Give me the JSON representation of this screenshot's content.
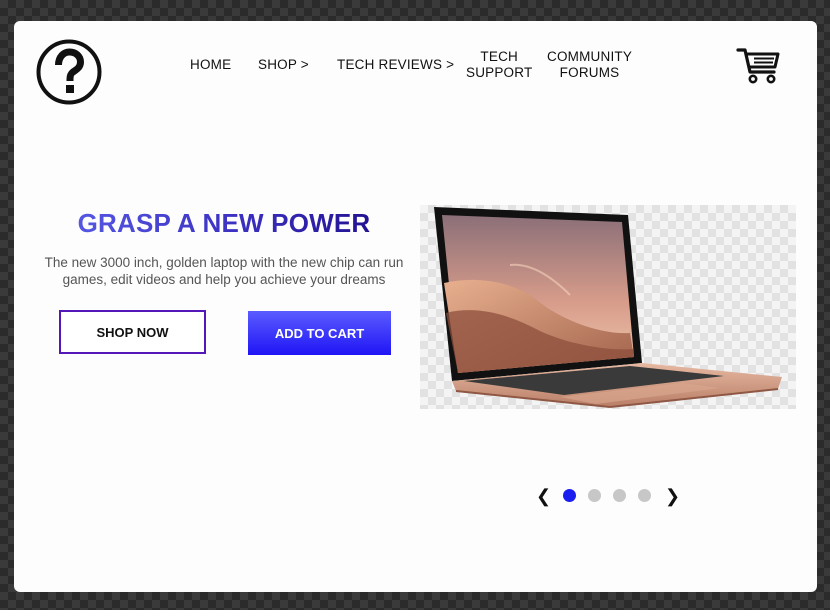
{
  "nav": {
    "home": "HOME",
    "shop": "SHOP >",
    "tech_reviews": "TECH REVIEWS >",
    "tech_support_line1": "TECH",
    "tech_support_line2": "SUPPORT",
    "community_line1": "COMMUNITY",
    "community_line2": "FORUMS"
  },
  "icons": {
    "logo": "question-mark-circle-icon",
    "cart": "shopping-cart-icon",
    "prev": "chevron-left-icon",
    "next": "chevron-right-icon"
  },
  "hero": {
    "headline": "GRASP A NEW POWER",
    "description": "The new 3000 inch, golden laptop with the new chip can run games, edit videos and help you achieve your dreams",
    "shop_now": "SHOP NOW",
    "add_to_cart": "ADD TO CART"
  },
  "carousel": {
    "total_slides": 4,
    "active_slide": 1
  },
  "colors": {
    "accent": "#1f15f5",
    "headline_start": "#5a5fe8",
    "headline_end": "#1c0b86",
    "shop_border": "#5418b8",
    "dot_active": "#1a1ff0",
    "dot_inactive": "#c7c7c7"
  }
}
